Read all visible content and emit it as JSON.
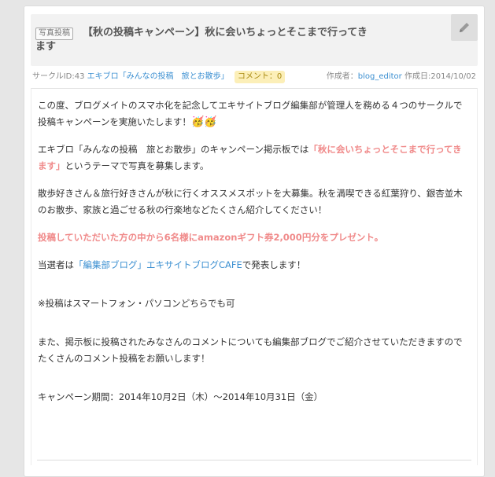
{
  "post": {
    "tag": "写真投稿",
    "title": "【秋の投稿キャンペーン】秋に会いちょっとそこまで行ってきます"
  },
  "meta": {
    "circle_id_label": "サークルID:43",
    "circle_name": "エキブロ「みんなの投稿　旅とお散歩」",
    "comment_badge": "コメント：0",
    "author_label": "作成者：",
    "author": "blog_editor",
    "created": "作成日:2014/10/02"
  },
  "body": {
    "p1": "この度、ブログメイトのスマホ化を記念してエキサイトブログ編集部が管理人を務める４つのサークルで投稿キャンペーンを実施いたします！",
    "p1_emoji": "🥳🥳",
    "p2_pre": "エキブロ「みんなの投稿　旅とお散歩」のキャンペーン掲示板では",
    "p2_hl": "「秋に会いちょっとそこまで行ってきます」",
    "p2_post": "というテーマで写真を募集します。",
    "p3": "散歩好きさん＆旅行好きさんが秋に行くオススメスポットを大募集。秋を満喫できる紅葉狩り、銀杏並木のお散歩、家族と過ごせる秋の行楽地などたくさん紹介してください！",
    "p4": "投稿していただいた方の中から6名様にamazonギフト券2,000円分をプレゼント。",
    "p5_pre": "当選者は",
    "p5_link": "「編集部ブログ」エキサイトブログCAFE",
    "p5_post": "で発表します！",
    "p6": "※投稿はスマートフォン・パソコンどちらでも可",
    "p7": "また、掲示板に投稿されたみなさんのコメントについても編集部ブログでご紹介させていただきますのでたくさんのコメント投稿をお願いします！",
    "p8": "キャンペーン期間：2014年10月2日（木）～2014年10月31日（金）"
  },
  "colors": {
    "highlight": "#f08a8a",
    "link": "#3b8fd1",
    "badge_bg": "#fcefb8"
  },
  "icons": {
    "edit": "pencil-icon"
  }
}
